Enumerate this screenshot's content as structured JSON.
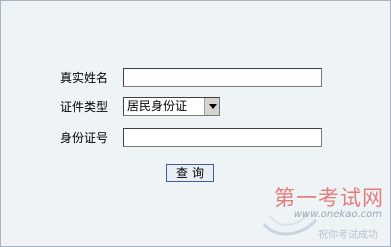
{
  "form": {
    "name_label": "真实姓名",
    "name_value": "",
    "id_type_label": "证件类型",
    "id_type_selected": "居民身份证",
    "id_number_label": "身份证号",
    "id_number_value": "",
    "query_button": "查询"
  },
  "watermark": {
    "title": "第一考试网",
    "url": "www.onekao.com",
    "slogan": "祝你考试成功"
  },
  "icons": {
    "dropdown": "chevron-down-icon"
  }
}
